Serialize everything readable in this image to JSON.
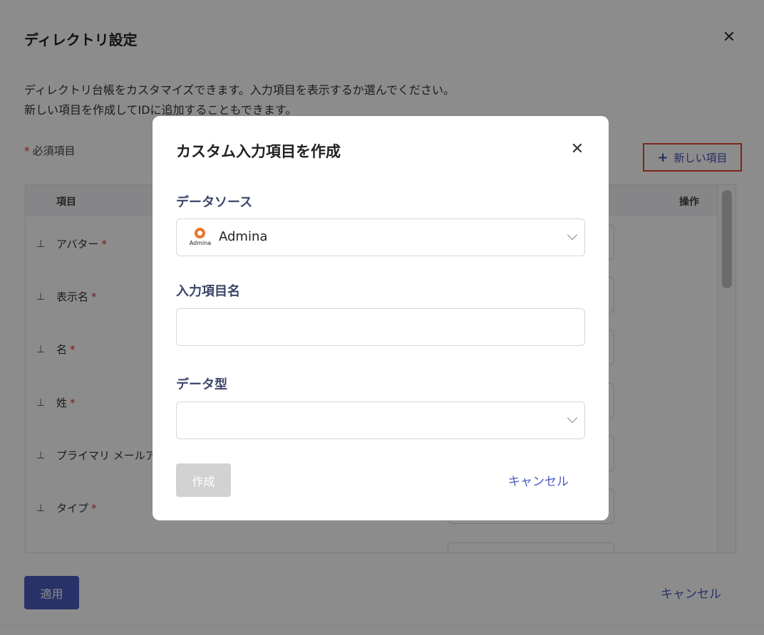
{
  "settings": {
    "title": "ディレクトリ設定",
    "close_icon": "close-icon",
    "description_line1": "ディレクトリ台帳をカスタマイズできます。入力項目を表示するか選んでください。",
    "description_line2": "新しい項目を作成してIDに追加することもできます。",
    "required_star": "*",
    "required_label": "必須項目",
    "new_item_plus": "+",
    "new_item_label": "新しい項目",
    "table": {
      "col_item": "項目",
      "col_op": "操作",
      "rows": [
        {
          "label": "アバター",
          "star": "*",
          "pin": "pin-icon"
        },
        {
          "label": "表示名",
          "star": "*",
          "pin": "pin-icon"
        },
        {
          "label": "名",
          "star": "*",
          "pin": "pin-icon"
        },
        {
          "label": "姓",
          "star": "*",
          "pin": "pin-icon"
        },
        {
          "label": "プライマリ メールア",
          "star": "",
          "pin": "pin-icon"
        },
        {
          "label": "タイプ",
          "star": "*",
          "pin": "pin-icon"
        }
      ]
    },
    "apply_label": "適用",
    "cancel_label": "キャンセル"
  },
  "modal": {
    "title": "カスタム入力項目を作成",
    "close_icon": "close-icon",
    "data_source_label": "データソース",
    "data_source_logo_text": "Admina",
    "data_source_value": "Admina",
    "field_name_label": "入力項目名",
    "field_name_value": "",
    "data_type_label": "データ型",
    "data_type_value": "",
    "create_label": "作成",
    "cancel_label": "キャンセル",
    "create_disabled": true
  },
  "colors": {
    "accent": "#4a5bc0",
    "highlight_border": "#e4462f",
    "required": "#dd3333",
    "logo": "#e8742b"
  }
}
